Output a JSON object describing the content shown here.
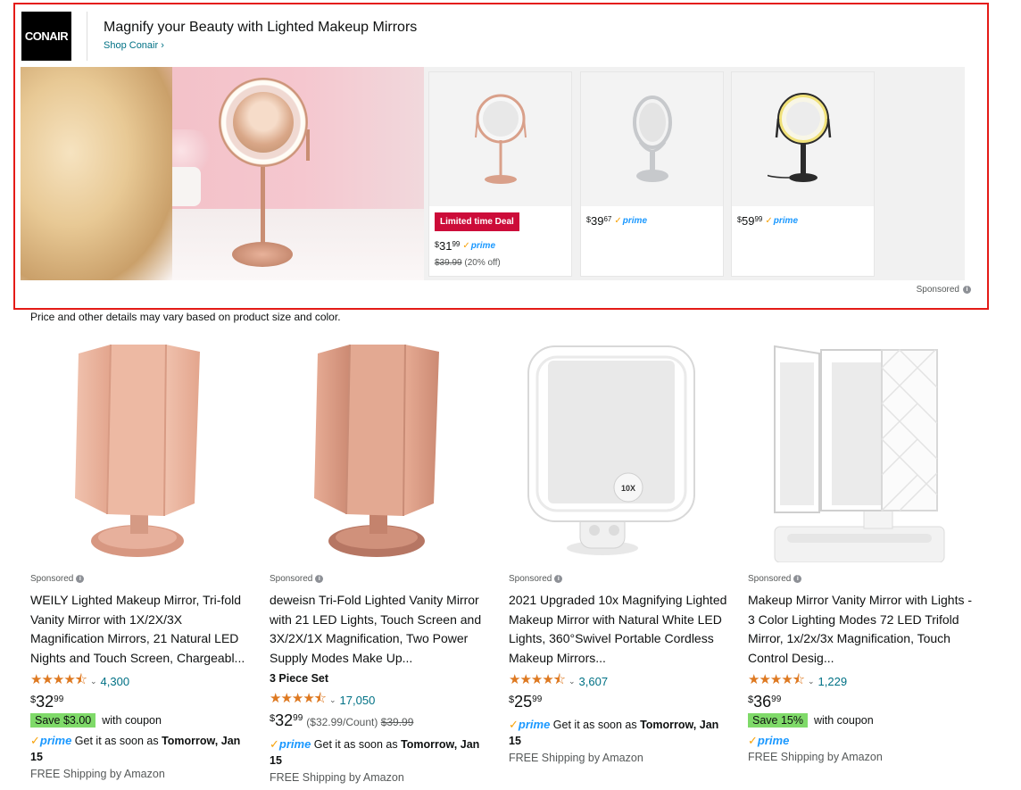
{
  "banner": {
    "brand_logo_text": "CONAIR",
    "headline": "Magnify your Beauty with Lighted Makeup Mirrors",
    "shop_link": "Shop Conair ›",
    "sponsored_label": "Sponsored",
    "products": [
      {
        "deal_label": "Limited time Deal",
        "price_symbol": "$",
        "price_whole": "31",
        "price_fraction": "99",
        "prime_label": "prime",
        "list_price": "$39.99",
        "savings": "(20% off)",
        "finish_color": "#d9a08a"
      },
      {
        "price_symbol": "$",
        "price_whole": "39",
        "price_fraction": "67",
        "prime_label": "prime",
        "finish_color": "#c7c9cc"
      },
      {
        "price_symbol": "$",
        "price_whole": "59",
        "price_fraction": "99",
        "prime_label": "prime",
        "finish_color": "#2b2b2b"
      }
    ]
  },
  "disclaimer": "Price and other details may vary based on product size and color.",
  "results": [
    {
      "sponsored_label": "Sponsored",
      "title": "WEILY Lighted Makeup Mirror, Tri-fold Vanity Mirror with 1X/2X/3X Magnification Mirrors, 21 Natural LED Nights and Touch Screen, Chargeabl...",
      "rating_stars": "★★★★⯪",
      "rating_count": "4,300",
      "price_symbol": "$",
      "price_whole": "32",
      "price_fraction": "99",
      "coupon_badge": "Save $3.00",
      "coupon_text": "with coupon",
      "prime_label": "prime",
      "delivery_prefix": "Get it as soon as",
      "delivery_date": "Tomorrow, Jan 15",
      "free_shipping": "FREE Shipping by Amazon"
    },
    {
      "sponsored_label": "Sponsored",
      "title": "deweisn Tri-Fold Lighted Vanity Mirror with 21 LED Lights, Touch Screen and 3X/2X/1X Magnification, Two Power Supply Modes Make Up...",
      "variant": "3 Piece Set",
      "rating_stars": "★★★★⯪",
      "rating_count": "17,050",
      "price_symbol": "$",
      "price_whole": "32",
      "price_fraction": "99",
      "unit_price": "($32.99/Count)",
      "list_price": "$39.99",
      "prime_label": "prime",
      "delivery_prefix": "Get it as soon as",
      "delivery_date": "Tomorrow, Jan 15",
      "free_shipping": "FREE Shipping by Amazon"
    },
    {
      "sponsored_label": "Sponsored",
      "title": "2021 Upgraded 10x Magnifying Lighted Makeup Mirror with Natural White LED Lights, 360°Swivel Portable Cordless Makeup Mirrors...",
      "rating_stars": "★★★★⯪",
      "rating_count": "3,607",
      "price_symbol": "$",
      "price_whole": "25",
      "price_fraction": "99",
      "prime_label": "prime",
      "delivery_prefix": "Get it as soon as",
      "delivery_date": "Tomorrow, Jan 15",
      "free_shipping": "FREE Shipping by Amazon",
      "magnification_label": "10X"
    },
    {
      "sponsored_label": "Sponsored",
      "title": "Makeup Mirror Vanity Mirror with Lights - 3 Color Lighting Modes 72 LED Trifold Mirror, 1x/2x/3x Magnification, Touch Control Desig...",
      "rating_stars": "★★★★⯪",
      "rating_count": "1,229",
      "price_symbol": "$",
      "price_whole": "36",
      "price_fraction": "99",
      "coupon_badge": "Save 15%",
      "coupon_text": "with coupon",
      "prime_label": "prime",
      "free_shipping": "FREE Shipping by Amazon"
    }
  ],
  "colors": {
    "banner_border": "#e41b17",
    "deal_badge": "#cc0c39",
    "coupon_badge": "#7fda69",
    "prime_blue": "#1a98ff",
    "star_orange": "#de7921",
    "link_teal": "#007185"
  }
}
